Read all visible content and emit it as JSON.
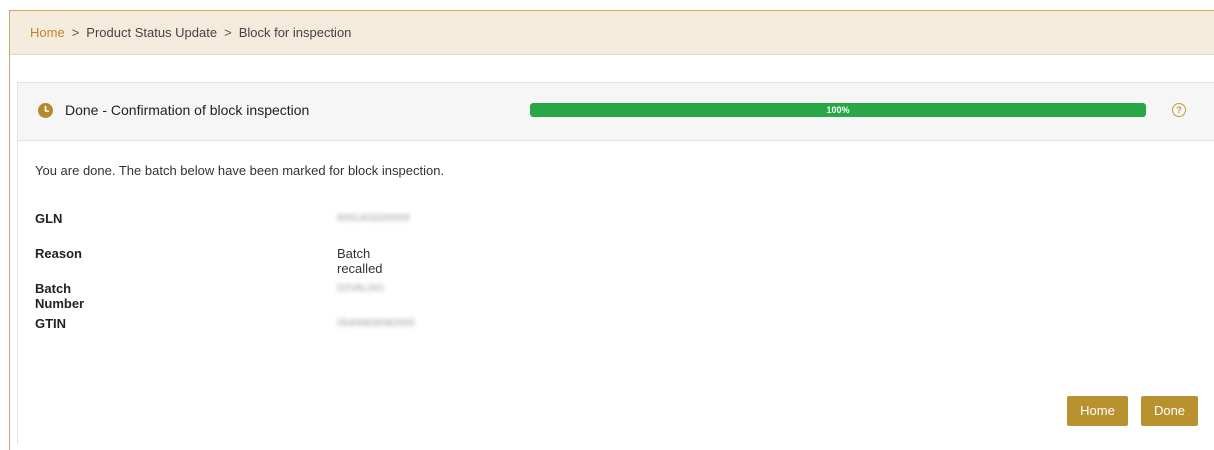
{
  "breadcrumb": {
    "home": "Home",
    "separator": ">",
    "section": "Product Status Update",
    "current": "Block for inspection"
  },
  "card": {
    "title": "Done - Confirmation of block inspection",
    "progress_label": "100%",
    "progress_percent": 100,
    "help_label": "?",
    "intro": "You are done. The batch below have been marked for block inspection."
  },
  "details": [
    {
      "label": "GLN",
      "value": "6091403200009"
    },
    {
      "label": "Reason",
      "value": "Batch recalled"
    },
    {
      "label": "Batch Number",
      "value": "D2VAL001"
    },
    {
      "label": "GTIN",
      "value": "05400835082555"
    }
  ],
  "buttons": {
    "home": "Home",
    "done": "Done"
  },
  "colors": {
    "accent": "#b8922f",
    "progress": "#27a745",
    "breadcrumb_bg": "#f4ebdd"
  }
}
